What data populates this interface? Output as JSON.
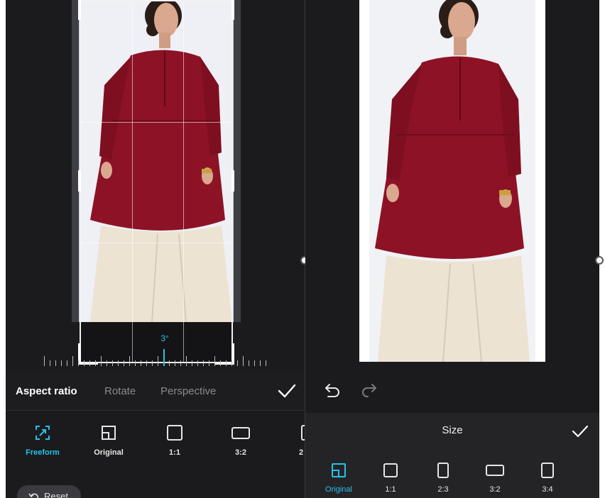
{
  "left_editor": {
    "rotation_angle": "3°",
    "tabs": [
      {
        "label": "Aspect ratio",
        "active": true
      },
      {
        "label": "Rotate",
        "active": false
      },
      {
        "label": "Perspective",
        "active": false
      }
    ],
    "confirm_icon": "check-icon",
    "ratios": [
      {
        "label": "Freeform",
        "icon": "freeform-icon",
        "active": true
      },
      {
        "label": "Original",
        "icon": "original-ratio-icon",
        "active": false
      },
      {
        "label": "1:1",
        "icon": "square-ratio-icon",
        "active": false
      },
      {
        "label": "3:2",
        "icon": "landscape-ratio-icon",
        "active": false
      },
      {
        "label": "2",
        "icon": "portrait-ratio-icon",
        "active": false
      }
    ],
    "reset_label": "Reset"
  },
  "right_editor": {
    "undo_icon": "undo-icon",
    "redo_icon": "redo-icon",
    "size_title": "Size",
    "confirm_icon": "check-icon",
    "sizes": [
      {
        "label": "Original",
        "icon": "original-ratio-icon",
        "active": true
      },
      {
        "label": "1:1",
        "icon": "square-ratio-icon",
        "active": false
      },
      {
        "label": "2:3",
        "icon": "portrait-ratio-icon",
        "active": false
      },
      {
        "label": "3:2",
        "icon": "landscape-ratio-icon",
        "active": false
      },
      {
        "label": "3:4",
        "icon": "portrait-ratio-icon",
        "active": false
      }
    ]
  },
  "colors": {
    "accent": "#27c2e6",
    "background": "#1b1b1d",
    "dress": "#8e1226",
    "trousers": "#ece3d2"
  }
}
